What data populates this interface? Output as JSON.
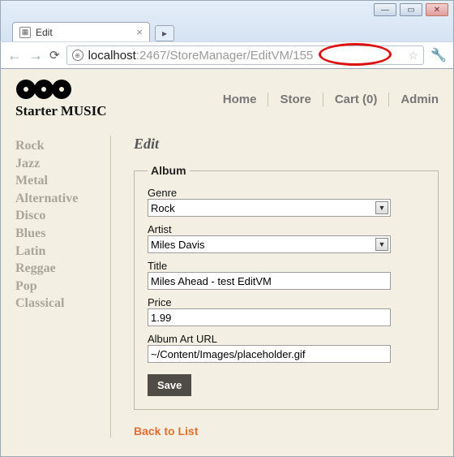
{
  "browser": {
    "tab_title": "Edit",
    "url_host": "localhost",
    "url_path": ":2467/StoreManager/EditVM/155"
  },
  "brand": "Starter MUSIC",
  "topnav": {
    "home": "Home",
    "store": "Store",
    "cart": "Cart (0)",
    "admin": "Admin"
  },
  "sidebar": {
    "categories": [
      "Rock",
      "Jazz",
      "Metal",
      "Alternative",
      "Disco",
      "Blues",
      "Latin",
      "Reggae",
      "Pop",
      "Classical"
    ]
  },
  "page_heading": "Edit",
  "fieldset_legend": "Album",
  "form": {
    "genre": {
      "label": "Genre",
      "value": "Rock"
    },
    "artist": {
      "label": "Artist",
      "value": "Miles Davis"
    },
    "title": {
      "label": "Title",
      "value": "Miles Ahead - test EditVM"
    },
    "price": {
      "label": "Price",
      "value": "1.99"
    },
    "art": {
      "label": "Album Art URL",
      "value": "~/Content/Images/placeholder.gif"
    },
    "save": "Save"
  },
  "back_link": "Back to List"
}
